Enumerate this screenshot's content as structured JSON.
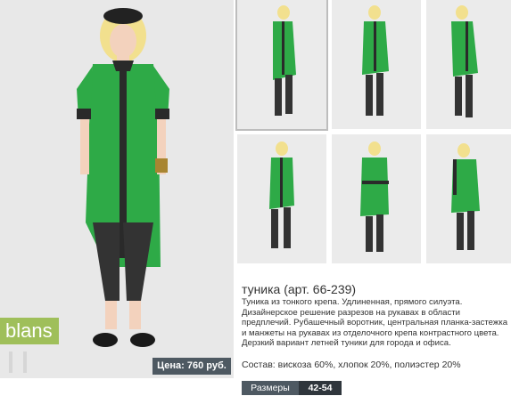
{
  "product": {
    "brand": "blans",
    "title": "туника (арт. 66-239)",
    "description": "Туника из тонкого крепа. Удлиненная, прямого силуэта. Дизайнерское решение разрезов на рукавах в области предплечий. Рубашечный воротник, центральная планка-застежка и манжеты на рукавах из отделочного крепа контрастного цвета. Дерзкий вариант летней туники для города и офиса.",
    "composition": "Состав: вискоза 60%, хлопок 20%, полиэстер 20%",
    "price": "Цена: 760 руб.",
    "sizes_label": "Размеры",
    "sizes_value": "42-54"
  },
  "colors": {
    "garment_green": "#2eaa47",
    "trim_dark": "#2a2a2a",
    "photo_bg": "#ebebeb",
    "brand_green": "#9fbf5a",
    "badge_dark": "#4e5962"
  }
}
